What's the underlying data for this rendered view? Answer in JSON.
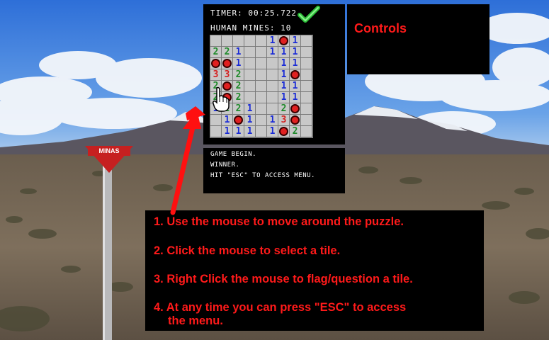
{
  "hud": {
    "timer_label": "TIMER: 00:25.722",
    "mines_label": "HUMAN MINES: 10",
    "check_icon": "checkmark-icon"
  },
  "board": [
    [
      "",
      "",
      "",
      "",
      "",
      "1",
      "M",
      "1",
      ""
    ],
    [
      "2",
      "2",
      "1",
      "",
      "",
      "1",
      "1",
      "1",
      ""
    ],
    [
      "M",
      "M",
      "1",
      "",
      "",
      "",
      "1",
      "1",
      ""
    ],
    [
      "3",
      "3",
      "2",
      "",
      "",
      "",
      "1",
      "M",
      ""
    ],
    [
      "2",
      "M",
      "2",
      "",
      "",
      "",
      "1",
      "1",
      ""
    ],
    [
      "2",
      "M",
      "2",
      "",
      "",
      "",
      "1",
      "1",
      ""
    ],
    [
      "1",
      "2",
      "2",
      "1",
      "",
      "",
      "2",
      "M",
      ""
    ],
    [
      "",
      "1",
      "M",
      "1",
      "",
      "1",
      "3",
      "M",
      ""
    ],
    [
      "",
      "1",
      "1",
      "1",
      "",
      "1",
      "M",
      "2",
      ""
    ]
  ],
  "log": {
    "line1": "GAME BEGIN.",
    "line2": "WINNER.",
    "line3": "HIT \"ESC\" TO ACCESS MENU."
  },
  "controls": {
    "title": "Controls"
  },
  "instructions": {
    "step1": "1. Use the mouse to move around the puzzle.",
    "step2": "2. Click the mouse to select a tile.",
    "step3": "3. Right Click the mouse to flag/question a tile.",
    "step4a": "4. At any time you can press \"ESC\" to access",
    "step4b": "the menu."
  },
  "sign": {
    "text": "MINAS"
  },
  "colors": {
    "accent": "#ff1a1a",
    "number_1": "#1a2bd6",
    "number_2": "#1f8a2a",
    "number_3": "#d42020"
  }
}
